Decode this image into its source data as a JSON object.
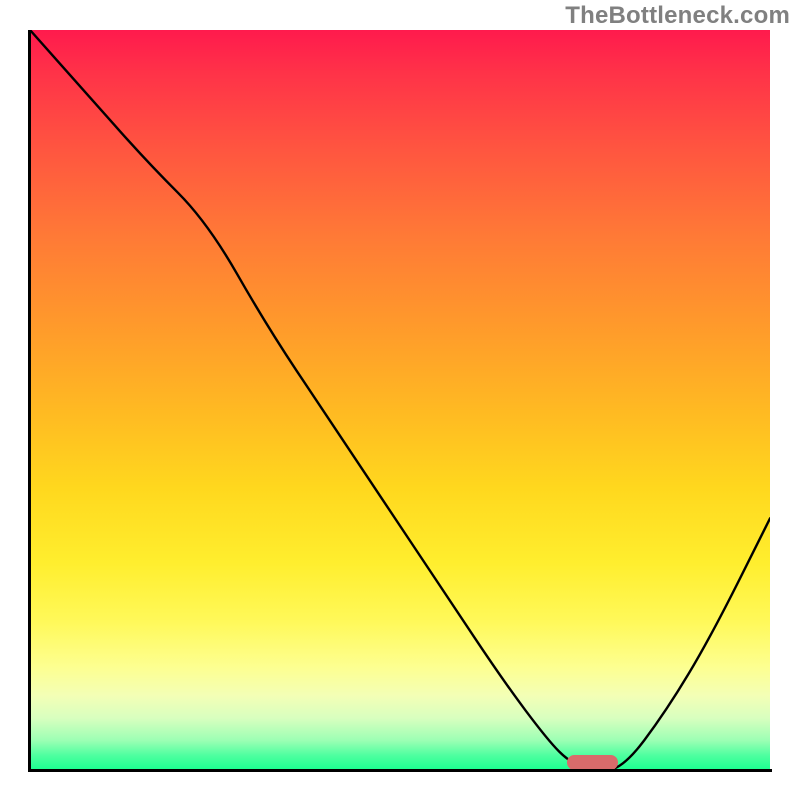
{
  "watermark": "TheBottleneck.com",
  "chart_data": {
    "type": "line",
    "title": "",
    "xlabel": "",
    "ylabel": "",
    "xlim": [
      0,
      100
    ],
    "ylim": [
      0,
      100
    ],
    "grid": false,
    "legend": false,
    "series": [
      {
        "name": "bottleneck-curve",
        "x": [
          0,
          8,
          16,
          24,
          32,
          40,
          48,
          56,
          64,
          70,
          73,
          76,
          80,
          86,
          92,
          100
        ],
        "y": [
          100,
          91,
          82,
          74,
          60,
          48,
          36,
          24,
          12,
          4,
          1,
          0,
          0,
          8,
          18,
          34
        ]
      }
    ],
    "annotations": [
      {
        "name": "optimal-marker",
        "shape": "pill",
        "color": "#d86b6b",
        "x": 76,
        "y": 0,
        "width_pct": 7,
        "height_pct": 2
      }
    ],
    "gradient_stops": [
      {
        "pct": 0,
        "color": "#ff1a4d"
      },
      {
        "pct": 50,
        "color": "#ffbb22"
      },
      {
        "pct": 80,
        "color": "#fff95a"
      },
      {
        "pct": 100,
        "color": "#1aff90"
      }
    ]
  }
}
